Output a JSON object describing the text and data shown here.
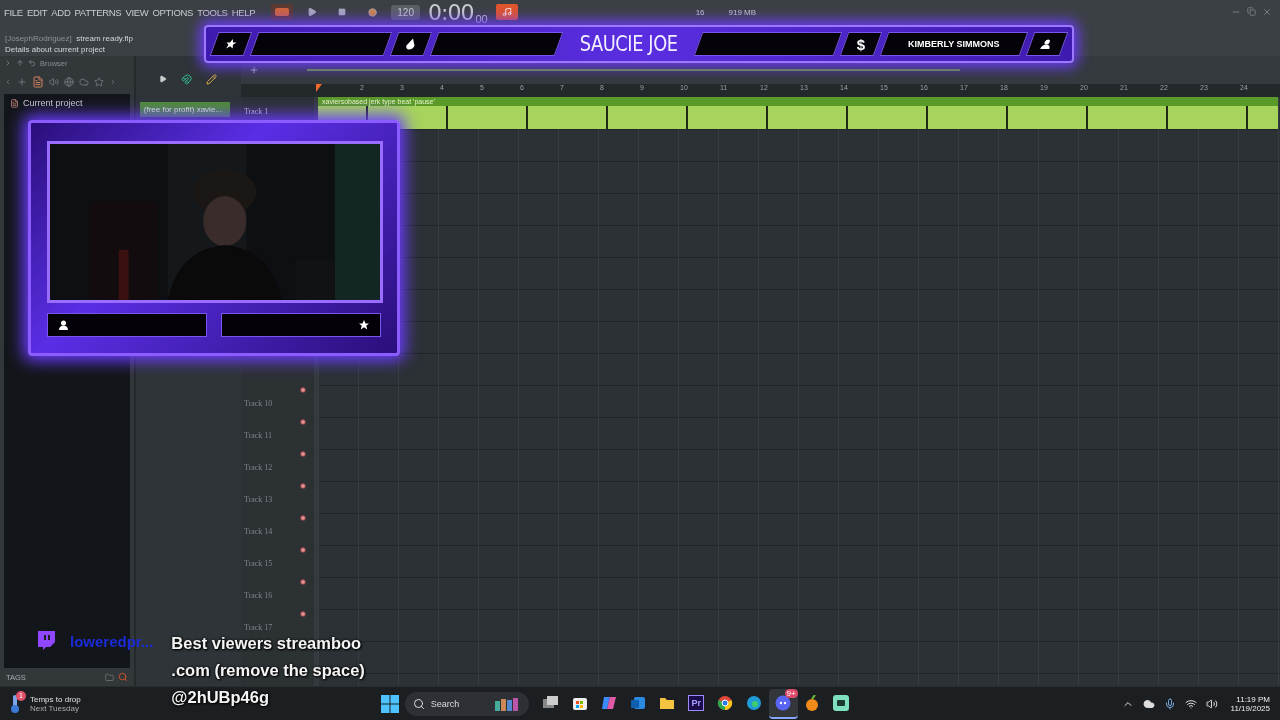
{
  "menu": [
    "FILE",
    "EDIT",
    "ADD",
    "PATTERNS",
    "VIEW",
    "OPTIONS",
    "TOOLS",
    "HELP"
  ],
  "transport": {
    "tempo": "120",
    "time": "0:00",
    "time_small": "00",
    "cpu": "16",
    "memory": "919 MB"
  },
  "hint": {
    "project": "[JosephRodriguez]",
    "file": "stream ready.flp",
    "details": "Details about current project"
  },
  "browser": {
    "title": "Browser",
    "folder": "Current project",
    "tags_label": "TAGS"
  },
  "channel": {
    "name": "(free for profit) xavie..."
  },
  "ruler": [
    "2",
    "3",
    "4",
    "5",
    "6",
    "7",
    "8",
    "9",
    "10",
    "11",
    "12",
    "13",
    "14",
    "15",
    "16",
    "17",
    "18",
    "19",
    "20",
    "21",
    "22",
    "23",
    "24"
  ],
  "tracks": [
    {
      "name": "Track 1",
      "clip": "xaviersobased jerk type beat 'pause'"
    },
    {
      "name": "Track 10"
    },
    {
      "name": "Track 11"
    },
    {
      "name": "Track 12"
    },
    {
      "name": "Track 13"
    },
    {
      "name": "Track 14"
    },
    {
      "name": "Track 15"
    },
    {
      "name": "Track 16"
    },
    {
      "name": "Track 17"
    }
  ],
  "banner": {
    "title": "SAUCIE JOE",
    "currency": "$",
    "name": "KIMBERLY SIMMONS"
  },
  "webcam": {
    "kind": "picture"
  },
  "chat": {
    "user": "loweredpr...",
    "lines": [
      "Best viewers streamboo",
      ".com (remove the space)",
      "@2hUBp46g"
    ]
  },
  "taskbar": {
    "weather_title": "Temps to drop",
    "weather_sub": "Next Tuesday",
    "weather_badge": "1",
    "search": "Search",
    "time": "11:19 PM",
    "date": "11/19/2025",
    "apps": [
      {
        "kind": "tasks",
        "selected": false
      },
      {
        "kind": "store",
        "selected": false
      },
      {
        "kind": "copilot",
        "selected": false
      },
      {
        "kind": "mail",
        "selected": false
      },
      {
        "kind": "folder",
        "selected": false
      },
      {
        "kind": "premiere",
        "label": "Pr",
        "selected": false
      },
      {
        "kind": "chrome",
        "selected": false
      },
      {
        "kind": "edge",
        "selected": false
      },
      {
        "kind": "discord",
        "badge": "9+",
        "selected": true
      },
      {
        "kind": "fruit",
        "selected": false
      },
      {
        "kind": "chat",
        "selected": false
      }
    ]
  }
}
